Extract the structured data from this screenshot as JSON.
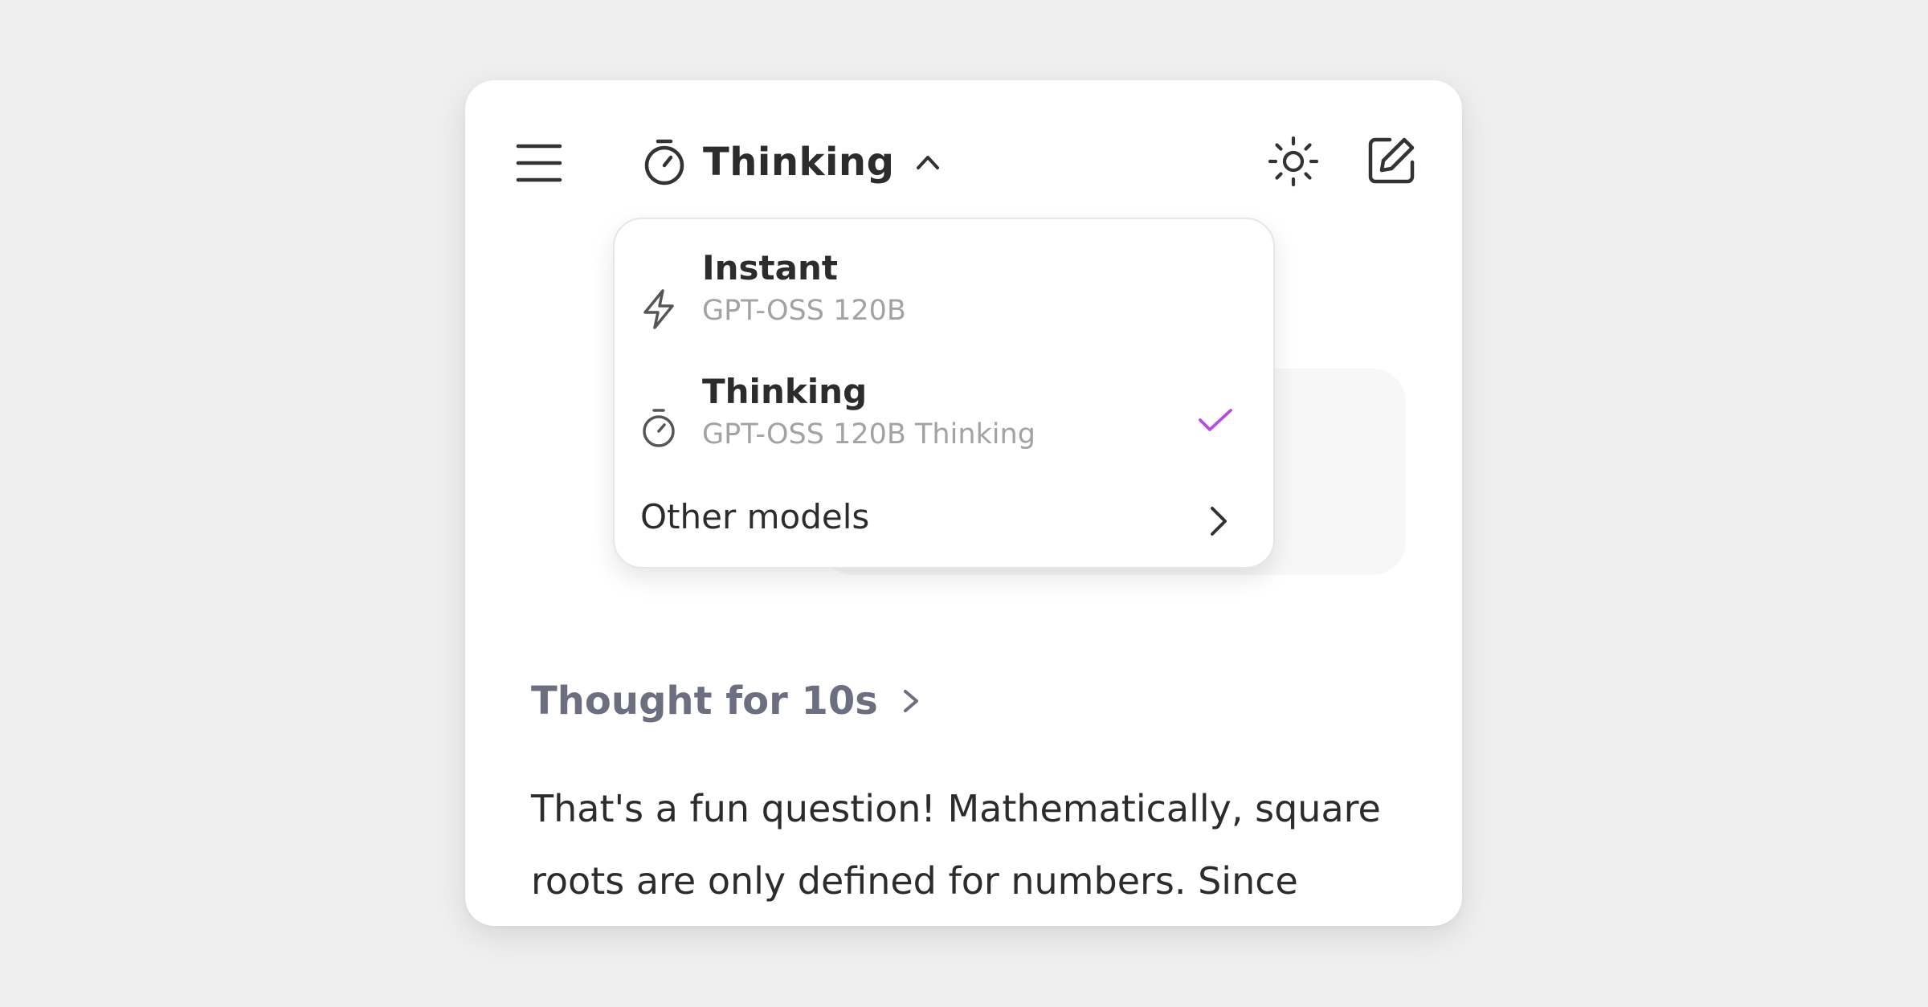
{
  "header": {
    "model_title": "Thinking"
  },
  "model_menu": {
    "options": [
      {
        "label": "Instant",
        "subtitle": "GPT-OSS 120B",
        "icon": "lightning-icon",
        "selected": false
      },
      {
        "label": "Thinking",
        "subtitle": "GPT-OSS 120B Thinking",
        "icon": "stopwatch-icon",
        "selected": true
      }
    ],
    "other_label": "Other models"
  },
  "thought": {
    "label": "Thought for 10s"
  },
  "answer": {
    "text": "That's a fun question! Mathematically, square roots are only defined for numbers. Since"
  },
  "colors": {
    "accent_check": "#b44de6",
    "thought_text": "#6b6f80"
  }
}
